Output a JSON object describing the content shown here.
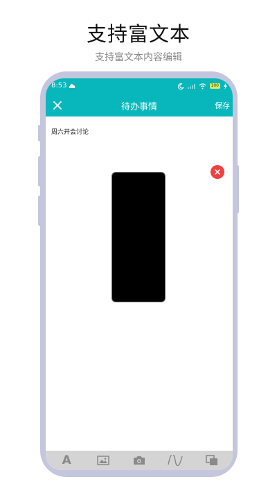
{
  "promo": {
    "title": "支持富文本",
    "subtitle": "支持富文本内容编辑"
  },
  "status_bar": {
    "time": "8:53",
    "battery": "100"
  },
  "app_bar": {
    "title": "待办事情",
    "save_label": "保存"
  },
  "editor": {
    "text": "周六开会讨论"
  },
  "toolbar": {
    "font_label": "A",
    "items": [
      "font-icon",
      "image-icon",
      "camera-icon",
      "draw-icon",
      "layers-icon"
    ]
  },
  "colors": {
    "accent": "#07b7bc",
    "frame": "#c3c6dd",
    "delete": "#f04040"
  }
}
